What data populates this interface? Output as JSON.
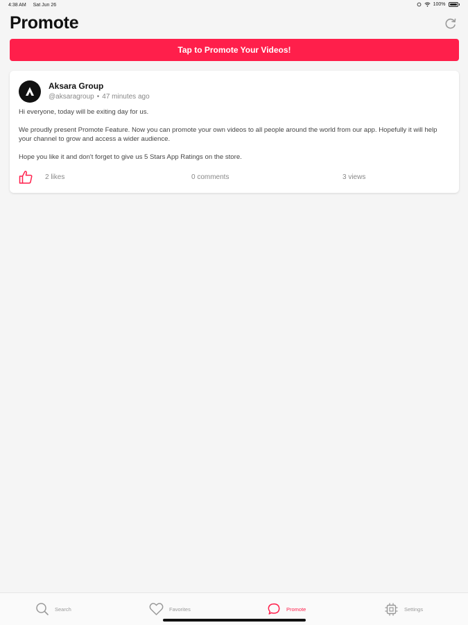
{
  "status_bar": {
    "time": "4:38 AM",
    "date": "Sat Jun 26",
    "battery": "100%"
  },
  "header": {
    "title": "Promote",
    "refresh_icon": "refresh-icon"
  },
  "promote_button": {
    "label": "Tap to Promote Your Videos!",
    "color": "#ff1f4b"
  },
  "post": {
    "author_name": "Aksara Group",
    "handle": "@aksaragroup",
    "separator": "•",
    "time_ago": "47 minutes ago",
    "paragraphs": [
      "Hi everyone, today will be exiting day for us.",
      "We proudly present Promote Feature. Now you can promote your own videos to all people around the world from our app. Hopefully it will help your channel to grow and access a wider audience.",
      "Hope you like it and don't forget to give us 5 Stars App Ratings on the store."
    ],
    "likes": "2 likes",
    "comments": "0 comments",
    "views": "3 views"
  },
  "tab_bar": {
    "tabs": [
      {
        "label": "Search",
        "icon": "search-icon",
        "active": false
      },
      {
        "label": "Favorites",
        "icon": "heart-icon",
        "active": false
      },
      {
        "label": "Promote",
        "icon": "chat-bubble-icon",
        "active": true
      },
      {
        "label": "Settings",
        "icon": "chip-icon",
        "active": false
      }
    ],
    "active_color": "#ff1f4b",
    "inactive_color": "#999999"
  }
}
